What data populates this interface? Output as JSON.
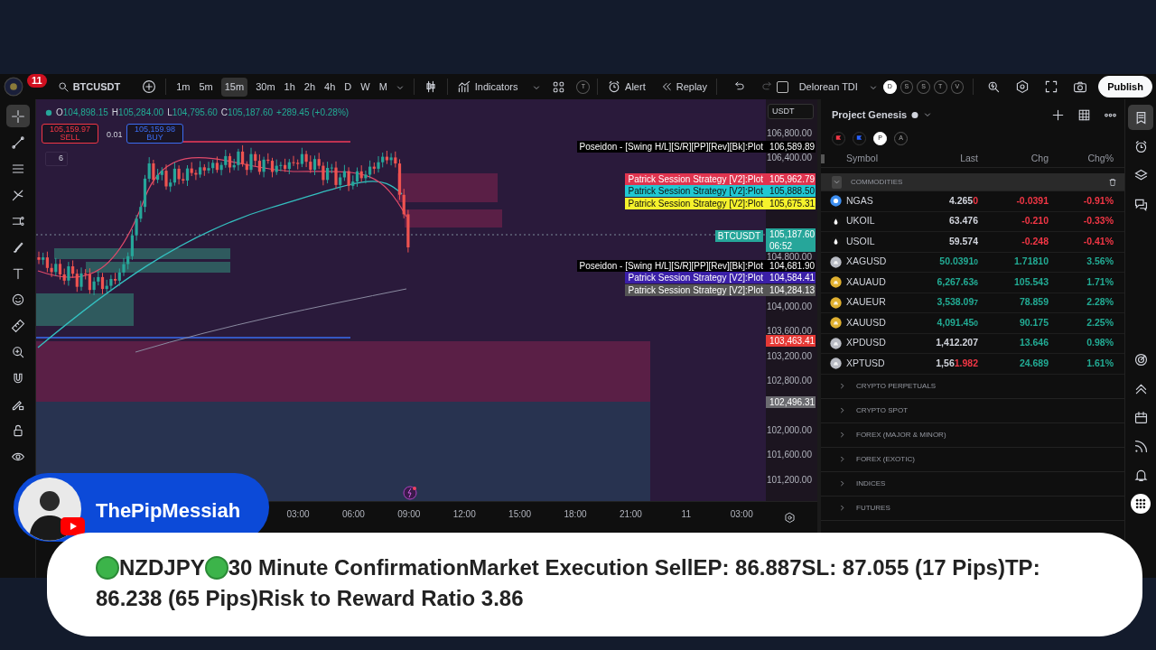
{
  "toolbar": {
    "notifications": "11",
    "symbol": "BTCUSDT",
    "intervals": [
      {
        "label": "1m",
        "selected": false
      },
      {
        "label": "5m",
        "selected": false
      },
      {
        "label": "15m",
        "selected": true
      },
      {
        "label": "30m",
        "selected": false
      },
      {
        "label": "1h",
        "selected": false
      },
      {
        "label": "2h",
        "selected": false
      },
      {
        "label": "4h",
        "selected": false
      },
      {
        "label": "D",
        "selected": false
      },
      {
        "label": "W",
        "selected": false
      },
      {
        "label": "M",
        "selected": false
      }
    ],
    "indicators": "Indicators",
    "template_badge": "T",
    "alert": "Alert",
    "replay": "Replay",
    "undo_disabled": false,
    "redo_disabled": true,
    "indicator_template": {
      "name": "Delorean TDI",
      "checked": false
    },
    "layouts": [
      {
        "label": "D",
        "selected": true
      },
      {
        "label": "S",
        "selected": false
      },
      {
        "label": "S",
        "selected": false
      },
      {
        "label": "T",
        "selected": false
      },
      {
        "label": "V",
        "selected": false
      }
    ],
    "publish": "Publish"
  },
  "drawing_tools": [
    {
      "kind": "crosshair",
      "selected": true
    },
    {
      "kind": "trendline",
      "selected": false
    },
    {
      "kind": "hlines",
      "selected": false
    },
    {
      "kind": "fork",
      "selected": false
    },
    {
      "kind": "pattern",
      "selected": false
    },
    {
      "kind": "brush",
      "selected": false
    },
    {
      "kind": "text",
      "selected": false
    },
    {
      "kind": "emoji",
      "selected": false
    },
    {
      "kind": "ruler",
      "selected": false
    },
    {
      "kind": "zoom",
      "selected": false
    },
    {
      "kind": "magnet",
      "selected": false
    },
    {
      "kind": "pencil_lock",
      "selected": false
    },
    {
      "kind": "lock",
      "selected": false
    },
    {
      "kind": "eye",
      "selected": false
    }
  ],
  "legend": {
    "items": [
      {
        "letter": "O",
        "value": "104,898.15"
      },
      {
        "letter": "H",
        "value": "105,284.00"
      },
      {
        "letter": "L",
        "value": "104,795.60"
      },
      {
        "letter": "C",
        "value": "105,187.60"
      }
    ],
    "change": "+289.45 (+0.28%)"
  },
  "trade": {
    "sell_price": "105,159.97",
    "sell": "SELL",
    "quantity": "0.01",
    "buy_price": "105,159.98",
    "buy": "BUY"
  },
  "indicators_count": "6",
  "currency": "USDT",
  "price_axis": [
    "106,800.00",
    "106,400.00",
    "104,800.00",
    "104,000.00",
    "103,600.00",
    "103,200.00",
    "102,800.00",
    "102,000.00",
    "101,600.00",
    "101,200.00"
  ],
  "price_labels": [
    {
      "text": "Poseidon - [Swing H/L][S/R][PP][Rev][Bk]:Plot",
      "value": "106,589.89",
      "color": "#000000"
    },
    {
      "text": "Patrick Session Strategy [V2]:Plot",
      "value": "105,962.79",
      "color": "#e0344f"
    },
    {
      "text": "Patrick Session Strategy [V2]:Plot",
      "value": "105,888.50",
      "color": "#1fc8d2"
    },
    {
      "text": "Patrick Session Strategy [V2]:Plot",
      "value": "105,675.31",
      "color": "#f5f22c"
    },
    {
      "text": "BTCUSDT",
      "value": "105,187.60",
      "countdown": "06:52",
      "color": "#26a69a"
    },
    {
      "text": "Poseidon - [Swing H/L][S/R][PP][Rev][Bk]:Plot",
      "value": "104,681.90",
      "color": "#000000"
    },
    {
      "text": "Patrick Session Strategy [V2]:Plot",
      "value": "104,584.41",
      "color": "#3a1fa8"
    },
    {
      "text": "Patrick Session Strategy [V2]:Plot",
      "value": "104,284.13",
      "color": "#555555"
    },
    {
      "value": "103,463.41",
      "color": "#e53935"
    },
    {
      "value": "102,496.31",
      "color": "#6b6b70"
    }
  ],
  "time_axis": [
    "03:00",
    "06:00",
    "09:00",
    "12:00",
    "15:00",
    "18:00",
    "21:00",
    "11",
    "03:00"
  ],
  "watchlist": {
    "title": "Project Genesis",
    "flags": [
      {
        "kind": "red_flag",
        "selected": false
      },
      {
        "kind": "blue_flag",
        "selected": false
      },
      {
        "kind": "letter",
        "label": "P",
        "selected": true
      },
      {
        "kind": "letter",
        "label": "A",
        "selected": false
      }
    ],
    "columns": [
      "Symbol",
      "Last",
      "Chg",
      "Chg%"
    ],
    "groups": [
      {
        "name": "COMMODITIES",
        "expanded": true,
        "rows": [
          {
            "symbol": "NGAS",
            "kind": "gas",
            "last": [
              {
                "text": "4.265",
                "color": "#d1d4dc"
              },
              {
                "text": "0",
                "color": "#f23645"
              }
            ],
            "chg": "-0.0391",
            "chg_pct": "-0.91%",
            "color": "#f23645"
          },
          {
            "symbol": "UKOIL",
            "kind": "oil",
            "last": [
              {
                "text": "63.476",
                "color": "#d1d4dc"
              }
            ],
            "chg": "-0.210",
            "chg_pct": "-0.33%",
            "color": "#f23645"
          },
          {
            "symbol": "USOIL",
            "kind": "oil",
            "last": [
              {
                "text": "59.574",
                "color": "#d1d4dc"
              }
            ],
            "chg": "-0.248",
            "chg_pct": "-0.41%",
            "color": "#f23645"
          },
          {
            "symbol": "XAGUSD",
            "kind": "silver",
            "last": [
              {
                "text": "50.0391",
                "color": "#22ab94"
              },
              {
                "text": "0",
                "color": "#22ab94",
                "small": true
              }
            ],
            "chg": "1.71810",
            "chg_pct": "3.56%",
            "color": "#22ab94"
          },
          {
            "symbol": "XAUAUD",
            "kind": "gold",
            "last": [
              {
                "text": "6,267.63",
                "color": "#22ab94"
              },
              {
                "text": "6",
                "color": "#22ab94",
                "small": true
              }
            ],
            "chg": "105.543",
            "chg_pct": "1.71%",
            "color": "#22ab94"
          },
          {
            "symbol": "XAUEUR",
            "kind": "gold",
            "last": [
              {
                "text": "3,538.09",
                "color": "#22ab94"
              },
              {
                "text": "7",
                "color": "#22ab94",
                "small": true
              }
            ],
            "chg": "78.859",
            "chg_pct": "2.28%",
            "color": "#22ab94"
          },
          {
            "symbol": "XAUUSD",
            "kind": "gold",
            "last": [
              {
                "text": "4,091.45",
                "color": "#22ab94"
              },
              {
                "text": "0",
                "color": "#22ab94",
                "small": true
              }
            ],
            "chg": "90.175",
            "chg_pct": "2.25%",
            "color": "#22ab94"
          },
          {
            "symbol": "XPDUSD",
            "kind": "silver",
            "last": [
              {
                "text": "1,412.207",
                "color": "#d1d4dc"
              }
            ],
            "chg": "13.646",
            "chg_pct": "0.98%",
            "color": "#22ab94"
          },
          {
            "symbol": "XPTUSD",
            "kind": "silver",
            "last": [
              {
                "text": "1,56",
                "color": "#d1d4dc"
              },
              {
                "text": "1.982",
                "color": "#f23645"
              }
            ],
            "chg": "24.689",
            "chg_pct": "1.61%",
            "color": "#22ab94"
          }
        ]
      },
      {
        "name": "CRYPTO PERPETUALS",
        "expanded": false
      },
      {
        "name": "CRYPTO SPOT",
        "expanded": false
      },
      {
        "name": "FOREX (MAJOR & MINOR)",
        "expanded": false
      },
      {
        "name": "FOREX (EXOTIC)",
        "expanded": false
      },
      {
        "name": "INDICES",
        "expanded": false
      },
      {
        "name": "FUTURES",
        "expanded": false
      }
    ]
  },
  "right_tools": [
    {
      "kind": "watchlist",
      "selected": true
    },
    {
      "kind": "clock",
      "selected": false
    },
    {
      "kind": "layers",
      "selected": false
    },
    {
      "kind": "chat",
      "selected": false
    },
    {
      "kind": "target",
      "selected": false
    },
    {
      "kind": "chevrons",
      "selected": false
    },
    {
      "kind": "calendar",
      "selected": false
    },
    {
      "kind": "signal",
      "selected": false
    },
    {
      "kind": "bell",
      "selected": false
    },
    {
      "kind": "apps",
      "selected": false
    }
  ],
  "channel": {
    "name": "ThePipMessiah"
  },
  "caption": {
    "lines": [
      [
        {
          "kind": "dot"
        },
        {
          "kind": "text",
          "text": "NZDJPY"
        },
        {
          "kind": "dot"
        },
        {
          "kind": "text",
          "text": "30 Minute ConfirmationMarket Execution SellEP: 86.887SL: 87.055 (17 Pips)TP:"
        }
      ],
      [
        {
          "kind": "text",
          "text": "86.238 (65 Pips)Risk to Reward Ratio 3.86"
        }
      ]
    ]
  }
}
